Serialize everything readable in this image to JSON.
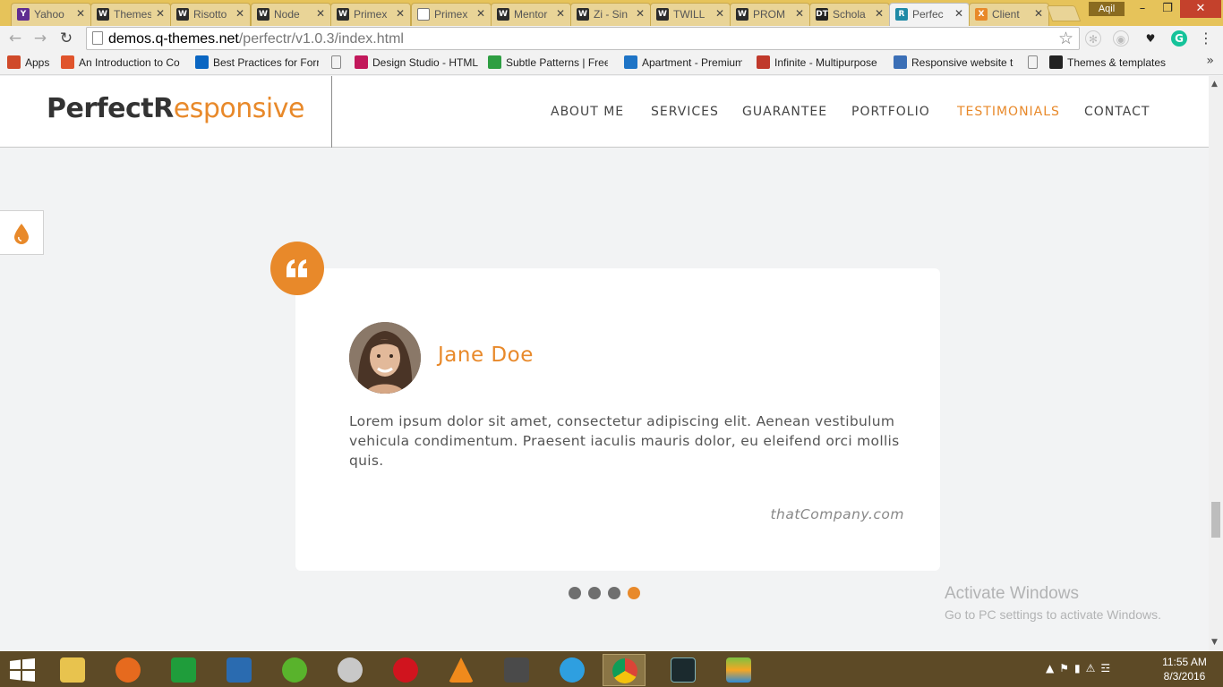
{
  "browser": {
    "tabs": [
      {
        "label": "Yahoo",
        "icon": "Y",
        "color": "#5f2d91"
      },
      {
        "label": "Themes",
        "icon": "W",
        "color": "#2b2b2b"
      },
      {
        "label": "Risotto",
        "icon": "W",
        "color": "#2b2b2b"
      },
      {
        "label": "Node",
        "icon": "W",
        "color": "#2b2b2b"
      },
      {
        "label": "Primex",
        "icon": "W",
        "color": "#2b2b2b"
      },
      {
        "label": "Primex",
        "icon": "doc",
        "color": "#ffffff"
      },
      {
        "label": "Mentor",
        "icon": "W",
        "color": "#2b2b2b"
      },
      {
        "label": "Zi - Sin",
        "icon": "W",
        "color": "#2b2b2b"
      },
      {
        "label": "TWILL",
        "icon": "W",
        "color": "#2b2b2b"
      },
      {
        "label": "PROM",
        "icon": "W",
        "color": "#2b2b2b"
      },
      {
        "label": "Schola",
        "icon": "DT",
        "color": "#222222"
      },
      {
        "label": "Perfec",
        "icon": "R",
        "color": "#1f8aa6"
      },
      {
        "label": "Client",
        "icon": "X",
        "color": "#e8892a"
      }
    ],
    "active_tab_index": 11,
    "user_name": "Aqil",
    "url_host": "demos.q-themes.net",
    "url_path": "/perfectr/v1.0.3/index.html",
    "bookmarks": [
      {
        "label": "Apps",
        "color": "#d04a2a"
      },
      {
        "label": "An Introduction to Co",
        "color": "#e0542c"
      },
      {
        "label": "Best Practices for Forr",
        "color": "#0a66c2"
      },
      {
        "label": "Design Studio - HTML",
        "color": "#c2185b"
      },
      {
        "label": "Subtle Patterns | Free",
        "color": "#2e9e42"
      },
      {
        "label": "Apartment - Premium",
        "color": "#1e74c6"
      },
      {
        "label": "Infinite - Multipurpose",
        "color": "#c0392b"
      },
      {
        "label": "Responsive website te",
        "color": "#3b6fb6"
      },
      {
        "label": "Themes & templates",
        "color": "#222222"
      }
    ]
  },
  "site": {
    "logo_bold": "PerfectR",
    "logo_light": "esponsive",
    "nav": [
      "ABOUT ME",
      "SERVICES",
      "GUARANTEE",
      "PORTFOLIO",
      "TESTIMONIALS",
      "CONTACT"
    ],
    "active_nav": "TESTIMONIALS",
    "accent": "#e8892a"
  },
  "testimonial": {
    "name": "Jane Doe",
    "text": "Lorem ipsum dolor sit amet, consectetur adipiscing elit. Aenean vestibulum vehicula condimentum. Praesent iaculis mauris dolor, eu eleifend orci mollis quis.",
    "company": "thatCompany.com",
    "slide_count": 4,
    "active_slide": 4
  },
  "watermark": {
    "title": "Activate Windows",
    "subtitle": "Go to PC settings to activate Windows."
  },
  "taskbar": {
    "time": "11:55 AM",
    "date": "8/3/2016"
  }
}
